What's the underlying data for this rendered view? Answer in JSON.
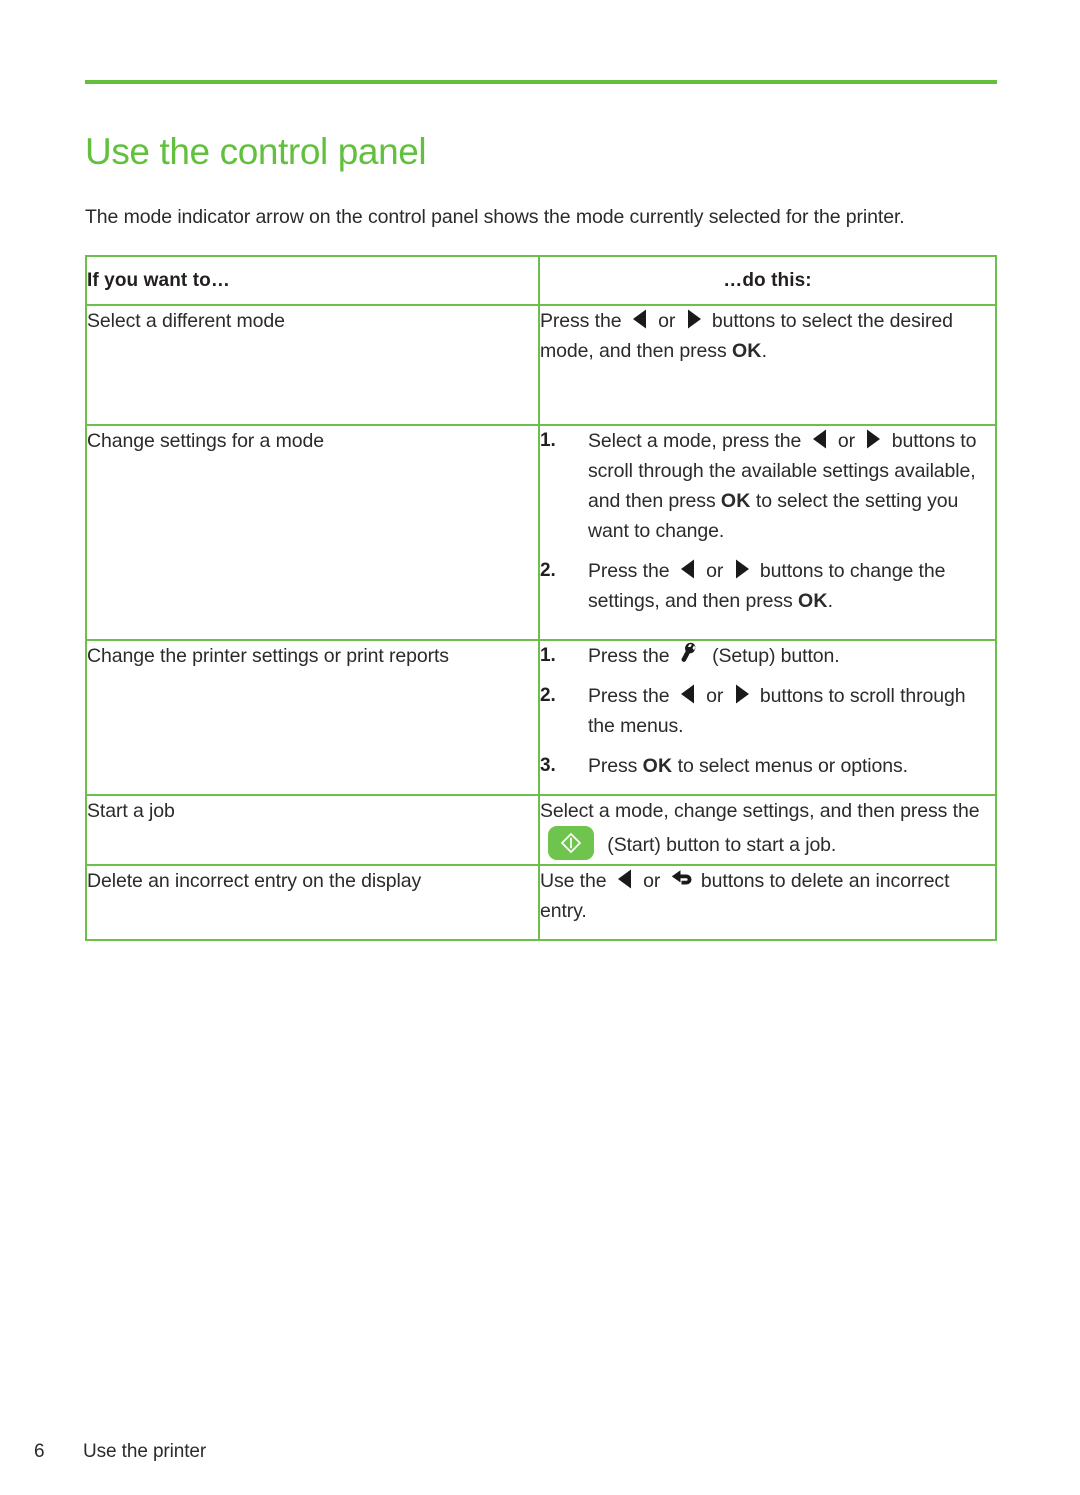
{
  "document": {
    "title": "Use the control panel",
    "intro": "The mode indicator arrow on the control panel shows the mode currently selected for the printer.",
    "accent_color": "#62c03e",
    "border_color": "#6cbf4b",
    "start_button_color": "#6ec44c",
    "text_color": "#2b2b2b"
  },
  "table": {
    "headers": {
      "col1": "If you want to…",
      "col2": "…do this:"
    },
    "rows": [
      {
        "task": "Select a different mode",
        "type": "plain",
        "parts": [
          "Press the ",
          {
            "icon": "left-arrow-icon"
          },
          " or ",
          {
            "icon": "right-arrow-icon"
          },
          " buttons to select the desired mode, and then press ",
          {
            "bold": "OK"
          },
          "."
        ]
      },
      {
        "task": "Change settings for a mode",
        "type": "steps",
        "steps": [
          {
            "number": "1.",
            "parts": [
              "Select a mode, press the ",
              {
                "icon": "left-arrow-icon"
              },
              " or ",
              {
                "icon": "right-arrow-icon"
              },
              " buttons to scroll through the available settings available, and then press ",
              {
                "bold": "OK"
              },
              " to select the setting you want to change."
            ]
          },
          {
            "number": "2.",
            "parts": [
              "Press the ",
              {
                "icon": "left-arrow-icon"
              },
              " or ",
              {
                "icon": "right-arrow-icon"
              },
              " buttons to change the settings, and then press ",
              {
                "bold": "OK"
              },
              "."
            ]
          }
        ]
      },
      {
        "task": "Change the printer settings or print reports",
        "type": "steps",
        "steps": [
          {
            "number": "1.",
            "parts": [
              "Press the ",
              {
                "icon": "wrench-setup-icon"
              },
              " (Setup) button."
            ]
          },
          {
            "number": "2.",
            "parts": [
              "Press the ",
              {
                "icon": "left-arrow-icon"
              },
              " or ",
              {
                "icon": "right-arrow-icon"
              },
              " buttons to scroll through the menus."
            ]
          },
          {
            "number": "3.",
            "parts": [
              "Press ",
              {
                "bold": "OK"
              },
              " to select menus or options."
            ]
          }
        ]
      },
      {
        "task": "Start a job",
        "type": "plain",
        "parts": [
          "Select a mode, change settings, and then press  the ",
          {
            "icon": "start-button-icon"
          },
          " (Start) button to start a job."
        ]
      },
      {
        "task": "Delete an incorrect entry on the display",
        "type": "plain",
        "parts": [
          "Use the ",
          {
            "icon": "left-arrow-icon"
          },
          " or ",
          {
            "icon": "back-arrow-icon"
          },
          " buttons to delete an incorrect entry."
        ]
      }
    ]
  },
  "footer": {
    "page_number": "6",
    "section": "Use the printer"
  }
}
